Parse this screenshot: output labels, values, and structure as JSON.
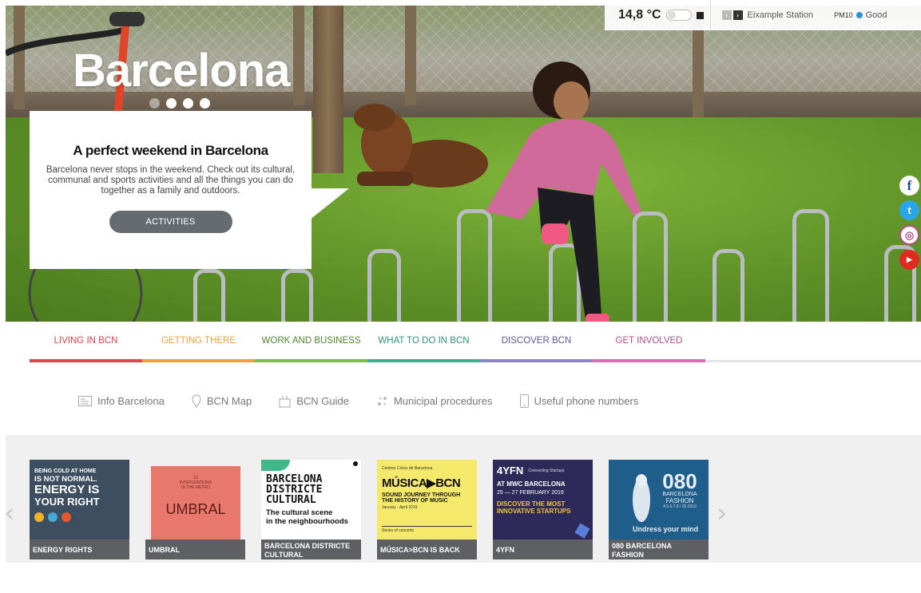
{
  "hero": {
    "title": "Barcelona",
    "promo": {
      "heading": "A perfect weekend in Barcelona",
      "text": "Barcelona never stops in the weekend. Check out its cultural, communal and sports activities and all the things you can do together as a family and outdoors.",
      "button": "ACTIVITIES"
    }
  },
  "weather": {
    "temp": "14,8 °C",
    "station": "Eixample Station",
    "pm_label": "PM10",
    "air_quality": "Good"
  },
  "social": {
    "facebook": "f",
    "twitter": "t",
    "instagram": "◎",
    "youtube": "▶"
  },
  "main_nav": [
    {
      "label": "LIVING IN BCN",
      "color": "#e4424d"
    },
    {
      "label": "GETTING THERE",
      "color": "#f0a23a"
    },
    {
      "label": "WORK AND BUSINESS",
      "color": "#7dbb4a"
    },
    {
      "label": "WHAT TO DO IN BCN",
      "color": "#3cb08e"
    },
    {
      "label": "DISCOVER BCN",
      "color": "#8f86c4"
    },
    {
      "label": "GET INVOLVED",
      "color": "#e06cb0"
    }
  ],
  "quick_links": [
    {
      "label": "Info Barcelona",
      "icon": "info-card-icon"
    },
    {
      "label": "BCN Map",
      "icon": "map-pin-icon"
    },
    {
      "label": "BCN Guide",
      "icon": "guide-icon"
    },
    {
      "label": "Municipal procedures",
      "icon": "procedures-icon"
    },
    {
      "label": "Useful phone numbers",
      "icon": "phone-icon"
    }
  ],
  "cards": [
    {
      "caption": "ENERGY RIGHTS",
      "art": [
        "BEING COLD AT HOME",
        "IS NOT NORMAL.",
        "ENERGY IS",
        "YOUR RIGHT"
      ]
    },
    {
      "caption": "UMBRAL",
      "art": [
        "15",
        "INTERVENTIONS",
        "IN THE METRO",
        "UMBRAL"
      ]
    },
    {
      "caption": "BARCELONA DISTRICTE CULTURAL",
      "art": [
        "BARCELONA",
        "DISTRICTE",
        "CULTURAL",
        "The cultural scene",
        "in the neighbourhoods"
      ]
    },
    {
      "caption": "MÚSICA>BCN IS BACK",
      "art": [
        "Centres Cívics de Barcelona",
        "MÚSICA▶BCN",
        "SOUND JOURNEY THROUGH",
        "THE HISTORY OF MUSIC",
        "January - April 2019",
        "Series of concerts"
      ]
    },
    {
      "caption": "4YFN",
      "art": [
        "4YFN",
        "Connecting Startups",
        "AT MWC BARCELONA",
        "25 — 27 FEBRUARY 2019",
        "DISCOVER THE MOST",
        "INNOVATIVE STARTUPS"
      ]
    },
    {
      "caption": "080 BARCELONA FASHION",
      "art": [
        "080",
        "BARCELONA",
        "FASHION",
        "4.5.6.7.8 / 02.2019",
        "Undress your mind"
      ]
    }
  ]
}
